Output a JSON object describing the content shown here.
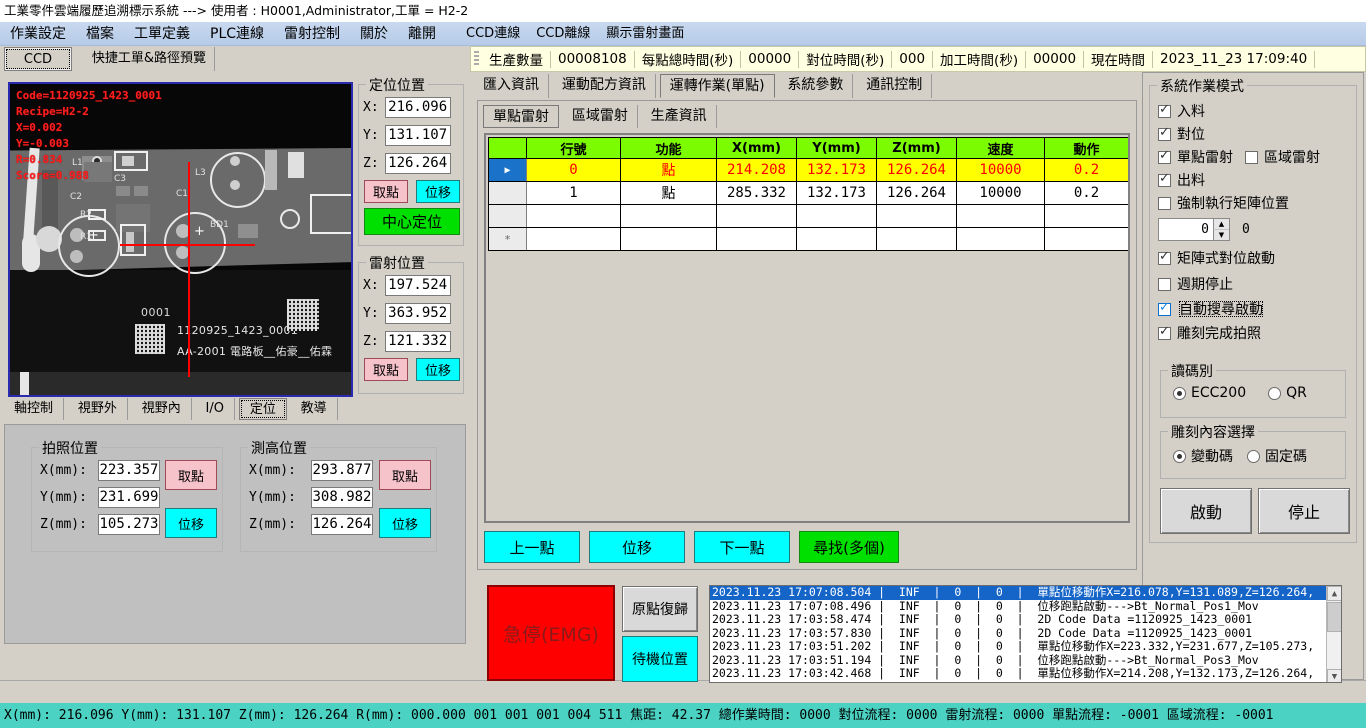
{
  "window": {
    "title": "工業零件雲端履歷追溯標示系統 ---> 使用者 : H0001,Administrator,工單 = H2-2"
  },
  "menu": {
    "items": [
      "作業設定",
      "檔案",
      "工單定義",
      "PLC連線",
      "雷射控制",
      "關於",
      "離開",
      "CCD連線",
      "CCD離線",
      "顯示雷射畫面"
    ]
  },
  "left_tabs": {
    "items": [
      "CCD",
      "快捷工單&路徑預覽"
    ],
    "selected": "CCD"
  },
  "info_strip": {
    "fields": [
      {
        "label": "生產數量",
        "value": "00008108"
      },
      {
        "label": "每點總時間(秒)",
        "value": "00000"
      },
      {
        "label": "對位時間(秒)",
        "value": "000"
      },
      {
        "label": "加工時間(秒)",
        "value": "00000"
      },
      {
        "label": "現在時間",
        "value": "2023_11_23  17:09:40"
      }
    ]
  },
  "camera": {
    "overlay": [
      "Code=1120925_1423_0001",
      "Recipe=H2-2",
      "X=0.002",
      "Y=-0.003",
      "R=0.834",
      "Score=0.988"
    ],
    "marking": {
      "serial": "0001",
      "code_text": "1120925_1423_0001",
      "part_text": "AA-2001  電路板__佑豪__佑霖"
    },
    "labels": [
      "L1",
      "C2",
      "C3",
      "C1",
      "L3",
      "R2",
      "R1",
      "BD1"
    ]
  },
  "locate_group": {
    "title": "定位位置",
    "x_label": "X:",
    "x_value": "216.096",
    "y_label": "Y:",
    "y_value": "131.107",
    "z_label": "Z:",
    "z_value": "126.264",
    "pick_label": "取點",
    "move_label": "位移",
    "center_label": "中心定位"
  },
  "laser_group": {
    "title": "雷射位置",
    "x_label": "X:",
    "x_value": "197.524",
    "y_label": "Y:",
    "y_value": "363.952",
    "z_label": "Z:",
    "z_value": "121.332",
    "pick_label": "取點",
    "move_label": "位移"
  },
  "left_sub_tabs": {
    "items": [
      "軸控制",
      "視野外",
      "視野內",
      "I/O",
      "定位",
      "教導"
    ],
    "selected": "定位"
  },
  "photo_group": {
    "title": "拍照位置",
    "x_label": "X(mm):",
    "x_value": "223.357",
    "y_label": "Y(mm):",
    "y_value": "231.699",
    "z_label": "Z(mm):",
    "z_value": "105.273",
    "pick_label": "取點",
    "move_label": "位移"
  },
  "height_group": {
    "title": "測高位置",
    "x_label": "X(mm):",
    "x_value": "293.877",
    "y_label": "Y(mm):",
    "y_value": "308.982",
    "z_label": "Z(mm):",
    "z_value": "126.264",
    "pick_label": "取點",
    "move_label": "位移"
  },
  "center_tabs": {
    "items": [
      "匯入資訊",
      "運動配方資訊",
      "運轉作業(單點)",
      "系統參數",
      "通訊控制"
    ],
    "selected": "運轉作業(單點)"
  },
  "center_subtabs": {
    "items": [
      "單點雷射",
      "區域雷射",
      "生產資訊"
    ],
    "selected": "單點雷射"
  },
  "point_table": {
    "columns": [
      "行號",
      "功能",
      "X(mm)",
      "Y(mm)",
      "Z(mm)",
      "速度",
      "動作"
    ],
    "rows": [
      {
        "selected": true,
        "marker": "▶",
        "cells": [
          "0",
          "點",
          "214.208",
          "132.173",
          "126.264",
          "10000",
          "0.2"
        ]
      },
      {
        "selected": false,
        "marker": "",
        "cells": [
          "1",
          "點",
          "285.332",
          "132.173",
          "126.264",
          "10000",
          "0.2"
        ]
      },
      {
        "selected": false,
        "marker": "",
        "cells": [
          "",
          "",
          "",
          "",
          "",
          "",
          ""
        ]
      },
      {
        "selected": false,
        "marker": "*",
        "cells": [
          "",
          "",
          "",
          "",
          "",
          "",
          ""
        ]
      }
    ]
  },
  "center_buttons": {
    "prev": "上一點",
    "move": "位移",
    "next": "下一點",
    "search": "尋找(多個)"
  },
  "emergency": {
    "emg_label": "急停(EMG)",
    "home_label": "原點復歸",
    "standby_label": "待機位置"
  },
  "sidebar": {
    "title": "系統作業模式",
    "checks": [
      {
        "label": "入料",
        "checked": true
      },
      {
        "label": "對位",
        "checked": true
      },
      {
        "label": "單點雷射",
        "checked": true
      },
      {
        "label": "區域雷射",
        "checked": false
      },
      {
        "label": "出料",
        "checked": true
      },
      {
        "label": "強制執行矩陣位置",
        "checked": false
      },
      {
        "label": "矩陣式對位啟動",
        "checked": true
      },
      {
        "label": "週期停止",
        "checked": false
      },
      {
        "label": "自動搜尋啟動",
        "checked": true
      },
      {
        "label": "雕刻完成拍照",
        "checked": true
      }
    ],
    "matrix_spin_value": "0",
    "matrix_side_value": "0",
    "reader_group": {
      "title": "讀碼別",
      "options": [
        {
          "label": "ECC200",
          "selected": true
        },
        {
          "label": "QR",
          "selected": false
        }
      ]
    },
    "content_group": {
      "title": "雕刻內容選擇",
      "options": [
        {
          "label": "變動碼",
          "selected": true
        },
        {
          "label": "固定碼",
          "selected": false
        }
      ]
    },
    "start_label": "啟動",
    "stop_label": "停止"
  },
  "log": {
    "lines": [
      {
        "selected": true,
        "text": "2023.11.23 17:07:08.504 |  INF  |  0  |  0  |  單點位移動作X=216.078,Y=131.089,Z=126.264,"
      },
      {
        "selected": false,
        "text": "2023.11.23 17:07:08.496 |  INF  |  0  |  0  |  位移跑點啟動--->Bt_Normal_Pos1_Mov"
      },
      {
        "selected": false,
        "text": "2023.11.23 17:03:58.474 |  INF  |  0  |  0  |  2D Code Data =1120925_1423_0001"
      },
      {
        "selected": false,
        "text": "2023.11.23 17:03:57.830 |  INF  |  0  |  0  |  2D Code Data =1120925_1423_0001"
      },
      {
        "selected": false,
        "text": "2023.11.23 17:03:51.202 |  INF  |  0  |  0  |  單點位移動作X=223.332,Y=231.677,Z=105.273,"
      },
      {
        "selected": false,
        "text": "2023.11.23 17:03:51.194 |  INF  |  0  |  0  |  位移跑點啟動--->Bt_Normal_Pos3_Mov"
      },
      {
        "selected": false,
        "text": "2023.11.23 17:03:42.468 |  INF  |  0  |  0  |  單點位移動作X=214.208,Y=132.173,Z=126.264,"
      }
    ]
  },
  "statusbar": {
    "text": "X(mm): 216.096 Y(mm): 131.107 Z(mm): 126.264 R(mm): 000.000 001 001 001 004 511 焦距: 42.37 總作業時間: 0000 對位流程: 0000 雷射流程: 0000  單點流程: -0001 區域流程: -0001"
  }
}
